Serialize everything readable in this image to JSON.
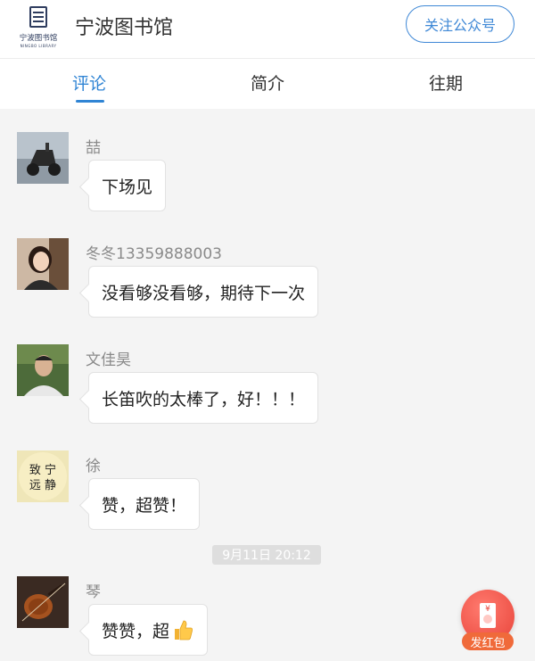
{
  "header": {
    "logo_text": "宁波图书馆",
    "logo_subtext": "NINGBO LIBRARY",
    "title": "宁波图书馆",
    "follow_button": "关注公众号"
  },
  "tabs": [
    {
      "label": "评论",
      "active": true
    },
    {
      "label": "简介",
      "active": false
    },
    {
      "label": "往期",
      "active": false
    }
  ],
  "comments": [
    {
      "name": "喆",
      "text": "下场见",
      "avatar": "avatar-scooter"
    },
    {
      "name": "冬冬13359888003",
      "text": "没看够没看够，期待下一次",
      "avatar": "avatar-woman"
    },
    {
      "name": "文佳昊",
      "text": "长笛吹的太棒了，好！！！",
      "avatar": "avatar-man"
    },
    {
      "name": "徐",
      "text": "赞，超赞！",
      "avatar": "avatar-calligraphy",
      "avatar_text": "致远 宁静"
    },
    {
      "name": "琴",
      "text": "赞赞，超",
      "avatar": "avatar-violin",
      "emoji": "thumbs-up-icon"
    }
  ],
  "timestamp": "9月11日 20:12",
  "red_packet": {
    "label": "发红包",
    "icon": "red-packet-icon"
  },
  "colors": {
    "accent": "#2f84d4",
    "red_packet": "#e8443a"
  }
}
